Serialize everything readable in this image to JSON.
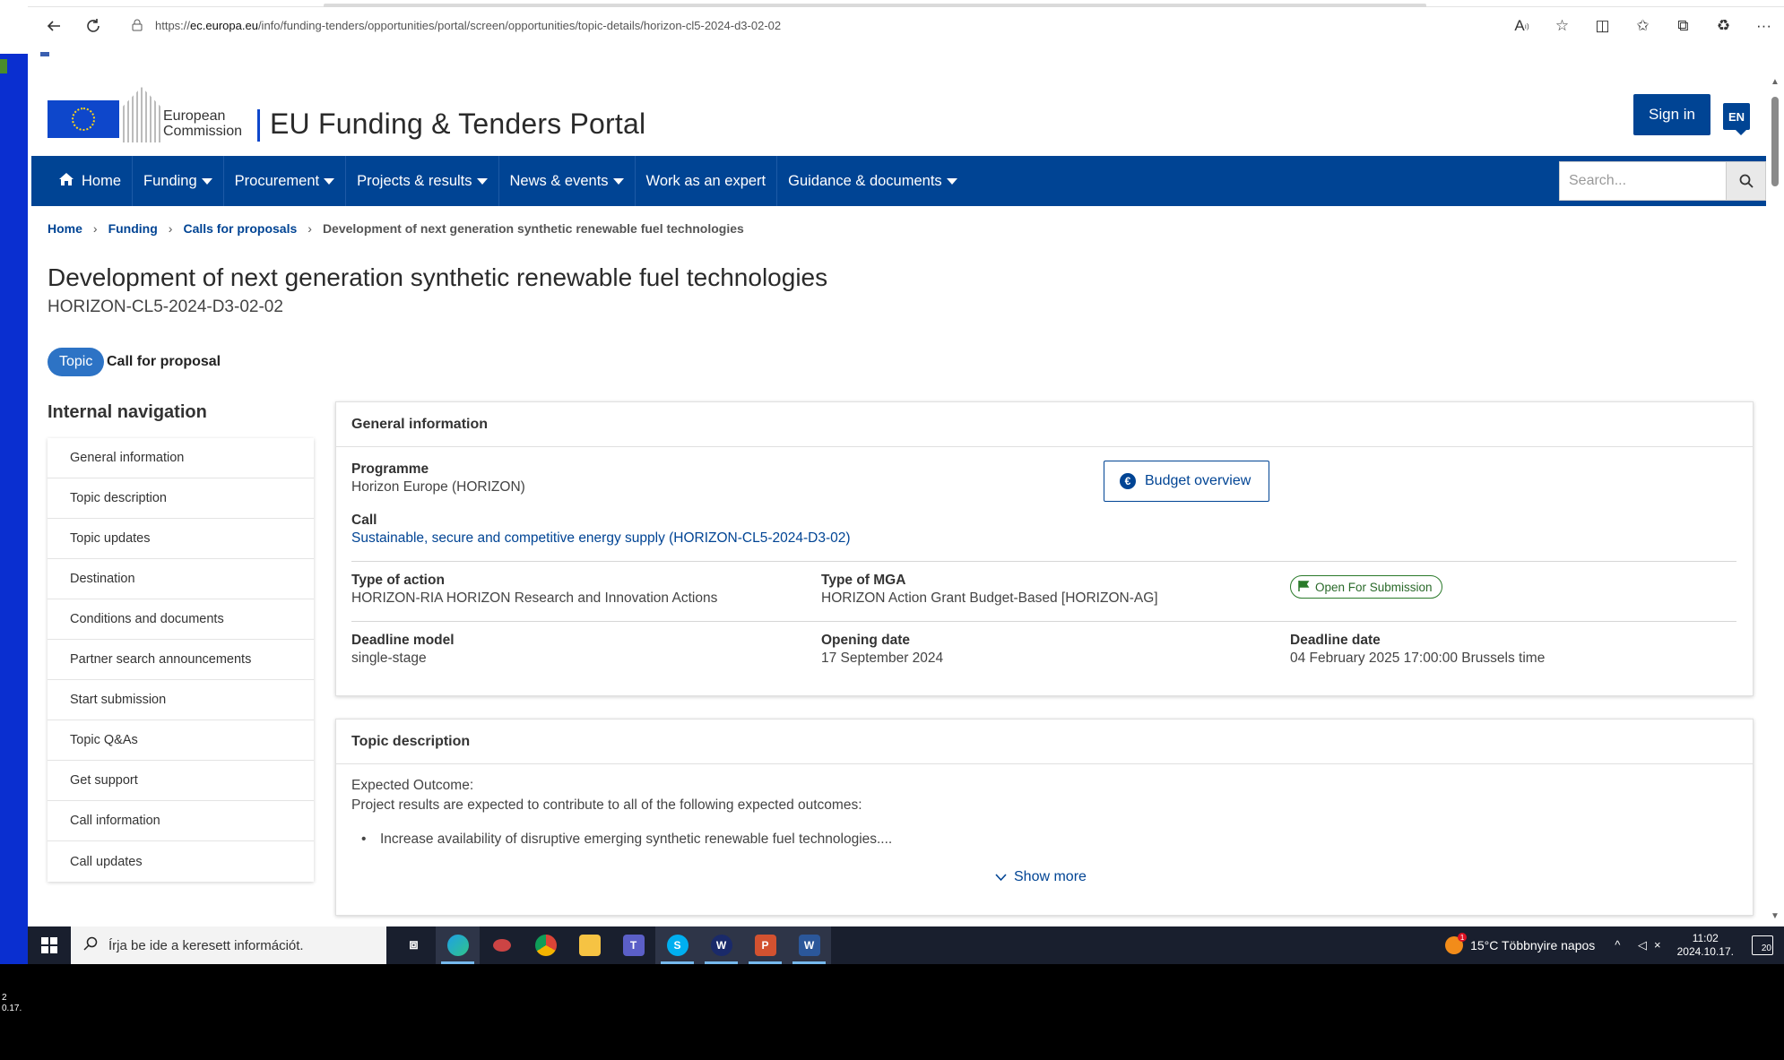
{
  "browser": {
    "url_prefix": "https://",
    "url_host": "ec.europa.eu",
    "url_path": "/info/funding-tenders/opportunities/portal/screen/opportunities/topic-details/horizon-cl5-2024-d3-02-02"
  },
  "header": {
    "ec_line1": "European",
    "ec_line2": "Commission",
    "portal_title": "EU Funding & Tenders Portal",
    "signin_label": "Sign in",
    "lang_label": "EN"
  },
  "nav": {
    "items": [
      "Home",
      "Funding",
      "Procurement",
      "Projects & results",
      "News & events",
      "Work as an expert",
      "Guidance & documents"
    ],
    "search_placeholder": "Search..."
  },
  "breadcrumb": {
    "items": [
      "Home",
      "Funding",
      "Calls for proposals",
      "Development of next generation synthetic renewable fuel technologies"
    ]
  },
  "topic": {
    "title": "Development of next generation synthetic renewable fuel technologies",
    "identifier": "HORIZON-CL5-2024-D3-02-02",
    "tag": "Topic",
    "type": "Call for proposal"
  },
  "internal_nav": {
    "title": "Internal navigation",
    "items": [
      "General information",
      "Topic description",
      "Topic updates",
      "Destination",
      "Conditions and documents",
      "Partner search announcements",
      "Start submission",
      "Topic Q&As",
      "Get support",
      "Call information",
      "Call updates"
    ]
  },
  "general_info": {
    "heading": "General information",
    "programme_label": "Programme",
    "programme_value": "Horizon Europe (HORIZON)",
    "budget_button": "Budget overview",
    "call_label": "Call",
    "call_value": "Sustainable, secure and competitive energy supply (HORIZON-CL5-2024-D3-02)",
    "type_action_label": "Type of action",
    "type_action_value": "HORIZON-RIA HORIZON Research and Innovation Actions",
    "type_mga_label": "Type of MGA",
    "type_mga_value": "HORIZON Action Grant Budget-Based [HORIZON-AG]",
    "status": "Open For Submission",
    "deadline_model_label": "Deadline model",
    "deadline_model_value": "single-stage",
    "opening_label": "Opening date",
    "opening_value": "17 September 2024",
    "deadline_label": "Deadline date",
    "deadline_value": "04 February 2025 17:00:00 Brussels time"
  },
  "topic_description": {
    "heading": "Topic description",
    "line1": "Expected Outcome:",
    "line2": "Project results are expected to contribute to all of the following expected outcomes:",
    "bullet1": "Increase availability of disruptive emerging synthetic renewable fuel technologies....",
    "show_more": "Show more"
  },
  "taskbar": {
    "search_placeholder": "Írja be ide a keresett információt.",
    "weather": "15°C  Többnyire napos",
    "time": "11:02",
    "date": "2024.10.17.",
    "notifications": "20"
  },
  "left_strip": {
    "fragment1": "2",
    "fragment2": "0.17."
  },
  "colors": {
    "brand_blue": "#004494",
    "nav_blue": "#004494",
    "tag_blue": "#2d73c5",
    "status_green": "#2a7a2a"
  }
}
